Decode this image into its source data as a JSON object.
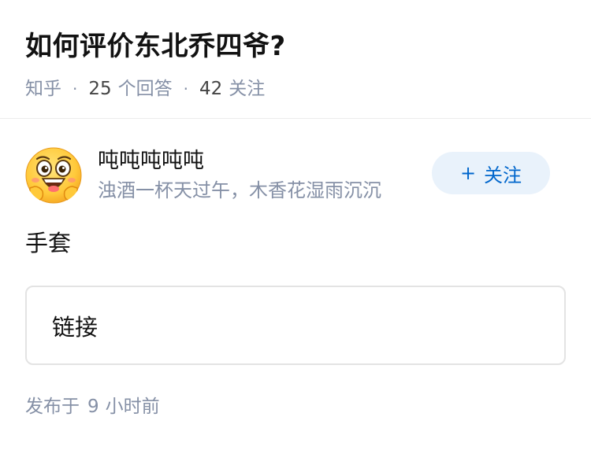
{
  "question": {
    "title": "如何评价东北乔四爷?",
    "source": "知乎",
    "answer_count": "25",
    "answer_count_unit": "个回答",
    "follow_count": "42",
    "follow_count_unit": "关注",
    "separator": "·"
  },
  "answer": {
    "author": {
      "name": "吨吨吨吨吨",
      "bio": "浊酒一杯天过午，木香花湿雨沉沉",
      "avatar_icon": "laughing-emoji-avatar-icon"
    },
    "follow_button": {
      "plus": "+",
      "label": "关注",
      "color": "#0066cc",
      "background": "#e9f2fb"
    },
    "content": "手套",
    "link_card": {
      "label": "链接"
    },
    "published": {
      "prefix": "发布于",
      "number": "9",
      "suffix": "小时前"
    }
  }
}
